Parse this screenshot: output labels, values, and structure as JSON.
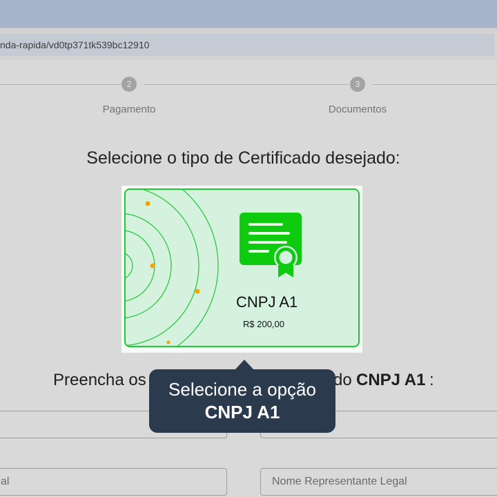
{
  "browser": {
    "url": "nda-rapida/vd0tp371tk539bc12910"
  },
  "stepper": {
    "steps": [
      {
        "number": "2",
        "label": "Pagamento"
      },
      {
        "number": "3",
        "label": "Documentos"
      }
    ]
  },
  "main": {
    "heading": "Selecione o tipo de Certificado desejado:",
    "card": {
      "title": "CNPJ A1",
      "price": "R$ 200,00",
      "icon": "certificate-icon",
      "accent_color": "#1dc830"
    },
    "form_heading_left": "Preencha os",
    "form_heading_middle": "do",
    "form_heading_product": "CNPJ A1",
    "form_heading_end": ":",
    "fields": {
      "row2_left_value": "al",
      "row2_right_placeholder": "Nome Representante Legal"
    }
  },
  "tooltip": {
    "line1": "Selecione a opção",
    "line2": "CNPJ A1",
    "background": "#2b3a4c"
  }
}
